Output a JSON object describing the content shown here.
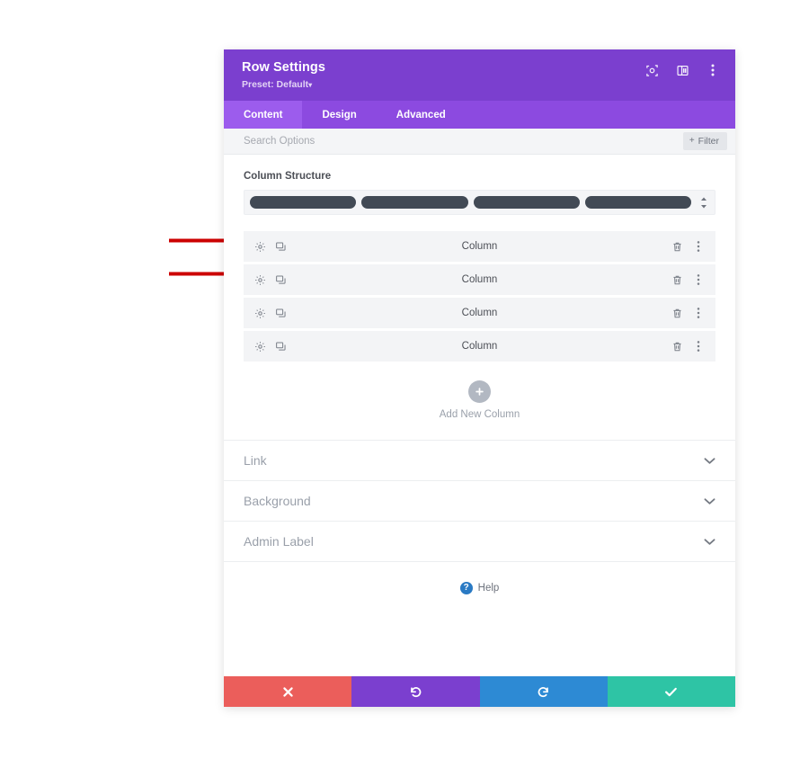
{
  "header": {
    "title": "Row Settings",
    "preset_label": "Preset: Default",
    "preset_caret": "▾",
    "icons": [
      {
        "name": "focus-target-icon"
      },
      {
        "name": "panel-layout-icon"
      },
      {
        "name": "vertical-dots-menu-icon"
      }
    ],
    "background_color": "#7b3fcf"
  },
  "tabs": [
    {
      "label": "Content",
      "active": true
    },
    {
      "label": "Design",
      "active": false
    },
    {
      "label": "Advanced",
      "active": false
    }
  ],
  "search": {
    "placeholder": "Search Options",
    "value": "",
    "filter_label": "Filter",
    "filter_plus": "+"
  },
  "column_structure": {
    "label": "Column Structure",
    "bars": 4,
    "stepper_up": "▴",
    "stepper_down": "▾",
    "bar_color": "#424a55"
  },
  "columns": [
    {
      "label": "Column"
    },
    {
      "label": "Column"
    },
    {
      "label": "Column"
    },
    {
      "label": "Column"
    }
  ],
  "add_column": {
    "label": "Add New Column",
    "plus": "+"
  },
  "toggles": [
    {
      "label": "Link"
    },
    {
      "label": "Background"
    },
    {
      "label": "Admin Label"
    }
  ],
  "help": {
    "label": "Help",
    "glyph": "?"
  },
  "footer": {
    "buttons": [
      {
        "name": "cancel-button",
        "glyph": "✖",
        "color": "#eb5e5b"
      },
      {
        "name": "undo-button",
        "glyph": "↺",
        "color": "#7b3fcf"
      },
      {
        "name": "redo-button",
        "glyph": "↻",
        "color": "#2d8ad4"
      },
      {
        "name": "save-button",
        "glyph": "✔",
        "color": "#2ec4a5"
      }
    ]
  },
  "annotations": {
    "arrow_color": "#cc0000",
    "arrows": 2
  }
}
